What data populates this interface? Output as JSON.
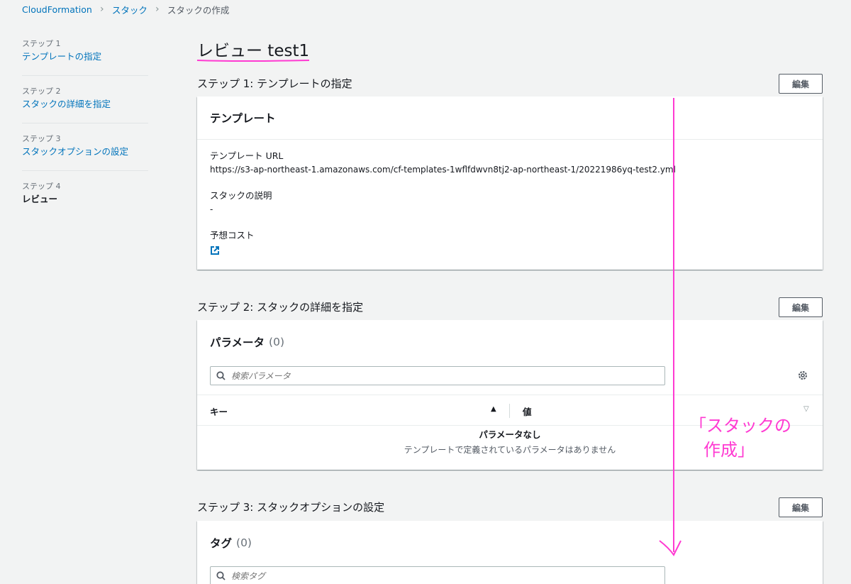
{
  "breadcrumb": {
    "items": [
      "CloudFormation",
      "スタック",
      "スタックの作成"
    ]
  },
  "steps": [
    {
      "num": "ステップ 1",
      "name": "テンプレートの指定"
    },
    {
      "num": "ステップ 2",
      "name": "スタックの詳細を指定"
    },
    {
      "num": "ステップ 3",
      "name": "スタックオプションの設定"
    },
    {
      "num": "ステップ 4",
      "name": "レビュー"
    }
  ],
  "page_title": "レビュー test1",
  "edit_label": "編集",
  "section1": {
    "title": "ステップ 1: テンプレートの指定",
    "panel_title": "テンプレート",
    "url_label": "テンプレート URL",
    "url_value": "https://s3-ap-northeast-1.amazonaws.com/cf-templates-1wflfdwvn8tj2-ap-northeast-1/20221986yq-test2.yml",
    "desc_label": "スタックの説明",
    "desc_value": "-",
    "cost_link": "予想コスト"
  },
  "section2": {
    "title": "ステップ 2: スタックの詳細を指定",
    "panel_title": "パラメータ",
    "count": "(0)",
    "search_placeholder": "検索パラメータ",
    "col_key": "キー",
    "col_value": "値",
    "empty_title": "パラメータなし",
    "empty_desc": "テンプレートで定義されているパラメータはありません"
  },
  "section3": {
    "title": "ステップ 3: スタックオプションの設定",
    "panel_title": "タグ",
    "count": "(0)",
    "search_placeholder": "検索タグ"
  },
  "annotation": {
    "line1": "「スタックの",
    "line2": "作成」",
    "color": "#ff3ad2"
  },
  "colors": {
    "link": "#0073bb",
    "background": "#f2f3f3",
    "text": "#16191f"
  }
}
